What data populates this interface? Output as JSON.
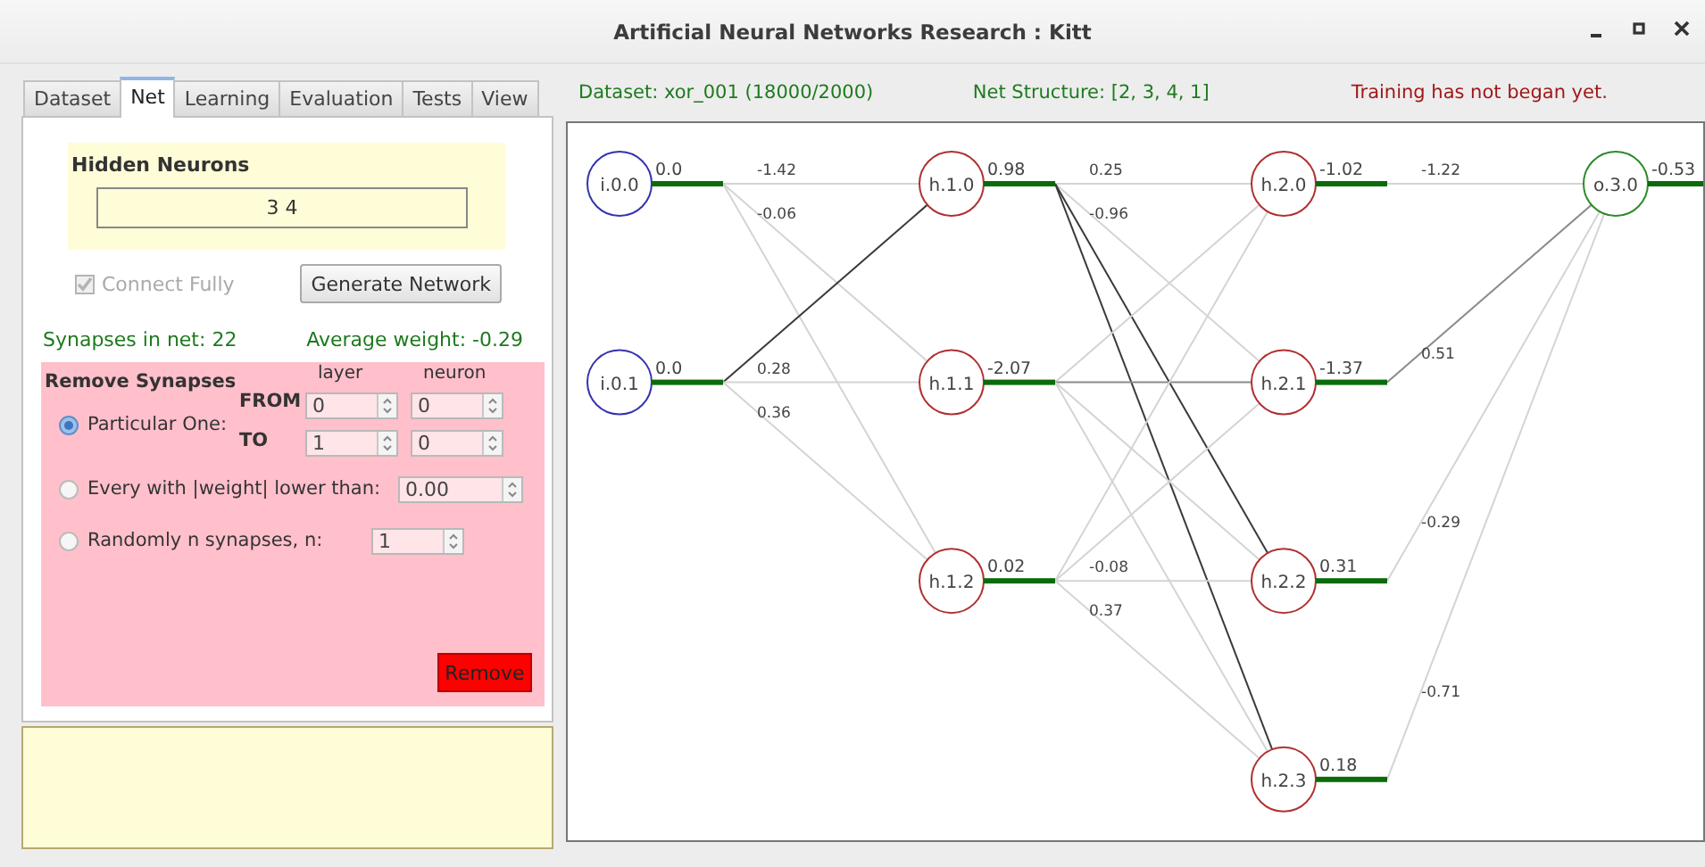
{
  "window": {
    "title": "Artificial Neural Networks Research : Kitt"
  },
  "tabs": [
    {
      "label": "Dataset",
      "selected": false
    },
    {
      "label": "Net",
      "selected": true
    },
    {
      "label": "Learning",
      "selected": false
    },
    {
      "label": "Evaluation",
      "selected": false
    },
    {
      "label": "Tests",
      "selected": false
    },
    {
      "label": "View",
      "selected": false
    }
  ],
  "hidden_neurons": {
    "label": "Hidden Neurons",
    "value": "3 4"
  },
  "connect_fully": {
    "label": "Connect Fully",
    "checked": true,
    "disabled": true
  },
  "generate_button": "Generate Network",
  "synapses_in_net": "Synapses in net: 22",
  "average_weight": "Average weight: -0.29",
  "remove_synapses": {
    "title": "Remove Synapses",
    "column_headers": [
      "layer",
      "neuron"
    ],
    "options": [
      {
        "kind": "particular",
        "label": "Particular One:",
        "selected": true,
        "from_label": "FROM",
        "to_label": "TO",
        "from": [
          "0",
          "0"
        ],
        "to": [
          "1",
          "0"
        ]
      },
      {
        "kind": "threshold",
        "label": "Every with |weight| lower than:",
        "selected": false,
        "value": "0.00"
      },
      {
        "kind": "random",
        "label": "Randomly n synapses, n:",
        "selected": false,
        "value": "1"
      }
    ],
    "button": "Remove"
  },
  "status": [
    {
      "kind": "info",
      "text": "Dataset: xor_001 (18000/2000)"
    },
    {
      "kind": "info",
      "text": "Net Structure: [2, 3, 4, 1]"
    },
    {
      "kind": "error",
      "text": "Training has not began yet."
    }
  ],
  "network": {
    "layers": [
      {
        "kind": "input",
        "neurons": [
          {
            "label": "i.0.0",
            "value": "0.0",
            "synapses": [
              {
                "kind": "light",
                "weight": "-1.42"
              },
              {
                "kind": "light",
                "weight": "-0.06"
              },
              {
                "kind": "light"
              }
            ]
          },
          {
            "label": "i.0.1",
            "value": "0.0",
            "synapses": [
              {
                "kind": "dark"
              },
              {
                "kind": "light",
                "weight": "0.28"
              },
              {
                "kind": "light",
                "weight": "0.36"
              }
            ]
          }
        ]
      },
      {
        "kind": "hidden",
        "neurons": [
          {
            "label": "h.1.0",
            "value": "0.98",
            "synapses": [
              {
                "kind": "light",
                "weight": "0.25"
              },
              {
                "kind": "light",
                "weight": "-0.96"
              },
              {
                "kind": "dark"
              },
              {
                "kind": "dark"
              }
            ]
          },
          {
            "label": "h.1.1",
            "value": "-2.07",
            "synapses": [
              {
                "kind": "light"
              },
              {
                "kind": "medium"
              },
              {
                "kind": "light"
              },
              {
                "kind": "light"
              }
            ]
          },
          {
            "label": "h.1.2",
            "value": "0.02",
            "synapses": [
              {
                "kind": "light"
              },
              {
                "kind": "light"
              },
              {
                "kind": "light",
                "weight": "-0.08"
              },
              {
                "kind": "light",
                "weight": "0.37"
              }
            ]
          }
        ]
      },
      {
        "kind": "hidden",
        "neurons": [
          {
            "label": "h.2.0",
            "value": "-1.02",
            "synapses": [
              {
                "kind": "light",
                "weight": "-1.22"
              }
            ]
          },
          {
            "label": "h.2.1",
            "value": "-1.37",
            "synapses": [
              {
                "kind": "medium",
                "weight": "0.51"
              }
            ]
          },
          {
            "label": "h.2.2",
            "value": "0.31",
            "synapses": [
              {
                "kind": "light",
                "weight": "-0.29"
              }
            ]
          },
          {
            "label": "h.2.3",
            "value": "0.18",
            "synapses": [
              {
                "kind": "light",
                "weight": "-0.71"
              }
            ]
          }
        ]
      },
      {
        "kind": "output",
        "neurons": [
          {
            "label": "o.3.0",
            "value": "-0.53"
          }
        ]
      }
    ]
  }
}
